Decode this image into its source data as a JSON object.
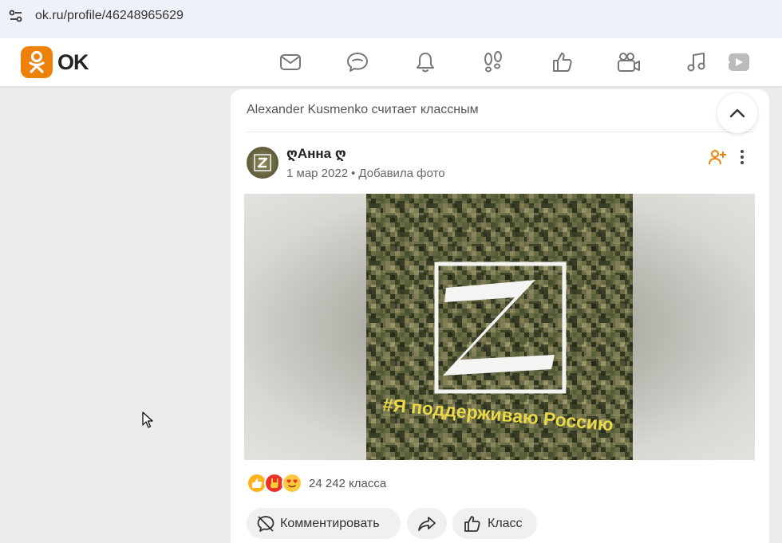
{
  "browser": {
    "url": "ok.ru/profile/46248965629"
  },
  "header": {
    "logo_text": "OK",
    "nav_icons": [
      "mail-icon",
      "chat-icon",
      "bell-icon",
      "footprints-icon",
      "like-icon",
      "video-camera-icon",
      "music-icon",
      "play-icon"
    ]
  },
  "feed": {
    "card_header": "Alexander Kusmenko считает классным",
    "post": {
      "author": "ღАнна ღ",
      "date": "1 мар 2022",
      "action": "Добавила фото",
      "photo": {
        "symbol": "Z",
        "caption": "#Я поддерживаю Россию"
      },
      "reactions": {
        "icons": [
          "thumbs-up-icon",
          "rock-hand-icon",
          "heart-eyes-icon"
        ],
        "count_label": "24 242 класса"
      },
      "buttons": {
        "comment": "Комментировать",
        "like": "Класс"
      }
    }
  },
  "colors": {
    "brand": "#ee8208",
    "accent_orange": "#ee8208",
    "background": "#ececec"
  }
}
